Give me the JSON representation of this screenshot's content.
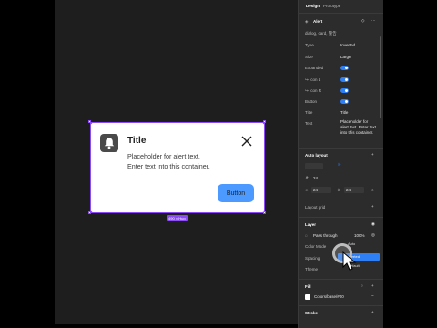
{
  "alert": {
    "title": "Title",
    "body_line1": "Placeholder for alert text.",
    "body_line2": "Enter text into this container.",
    "button_label": "Button",
    "size_badge": "490 × Hug"
  },
  "panel": {
    "tabs": [
      "Design",
      "Prototype"
    ],
    "component_name": "Alert",
    "component_desc": "dialog, card, 警告",
    "props": [
      {
        "label": "Type",
        "value": "Inverted"
      },
      {
        "label": "Size",
        "value": "Large"
      },
      {
        "label": "Expanded",
        "value": ""
      },
      {
        "label": "↪ Icon L",
        "value": ""
      },
      {
        "label": "↪ Icon R",
        "value": ""
      },
      {
        "label": "Button",
        "value": ""
      },
      {
        "label": "Title",
        "value": "Title"
      },
      {
        "label": "Text",
        "value": "Placeholder for alert text. Enter text into this container."
      }
    ],
    "auto_layout": {
      "label": "Auto layout",
      "spacing": "24",
      "pad_h": "24",
      "pad_v": "24"
    },
    "layout_grid": "Layout grid",
    "layer": {
      "label": "Layer",
      "blend": "Pass through",
      "opacity": "100%",
      "color_mode": "Color Mode",
      "spacing": "Spacing",
      "theme": "Theme"
    },
    "menu": {
      "items": [
        "Auto",
        "Inverted",
        "Default"
      ],
      "selected": "Inverted"
    },
    "fill": {
      "label": "Fill",
      "swatch_name": "Colors/base/#00",
      "swatch_color": "#ffffff"
    },
    "stroke": "Stroke"
  },
  "colors": {
    "selection": "#8c4cf5",
    "accent": "#2f7ff5",
    "button": "#4c9aff"
  }
}
